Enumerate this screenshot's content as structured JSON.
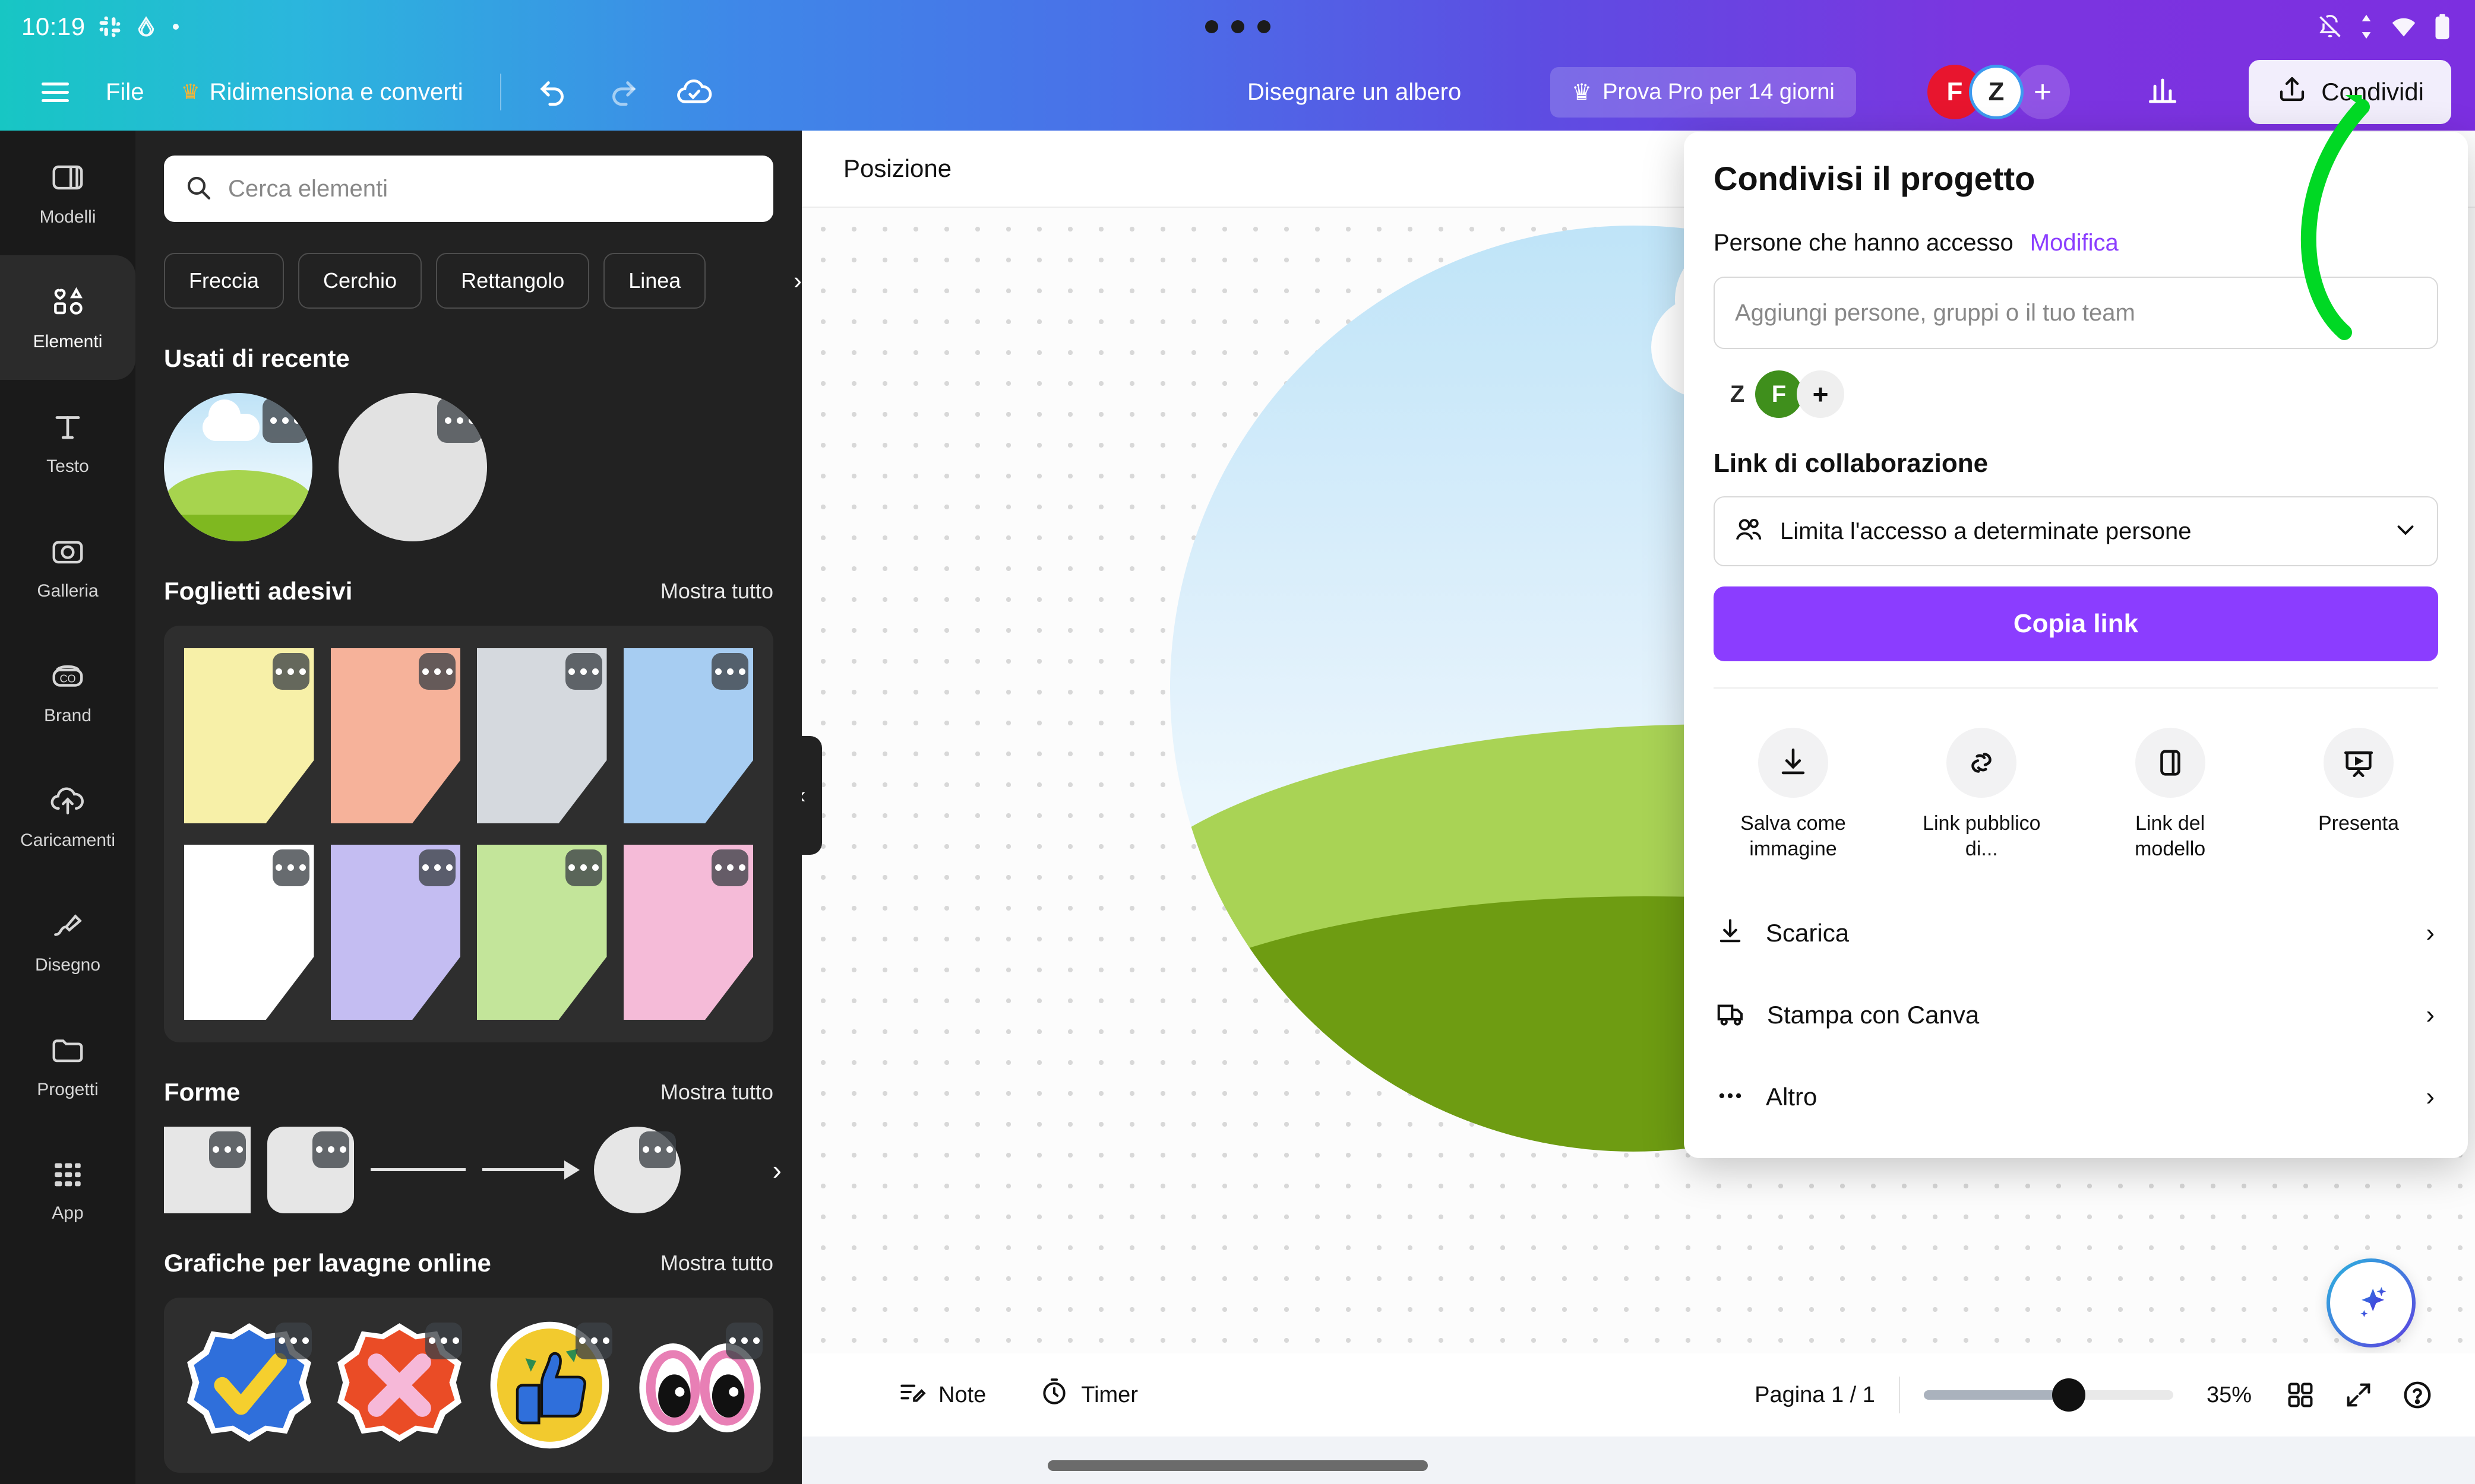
{
  "os": {
    "time": "10:19",
    "icons": [
      "slack-icon",
      "drive-icon",
      "recording-dot-icon"
    ],
    "right_icons": [
      "bell-off-icon",
      "data-transfer-icon",
      "wifi-icon",
      "battery-icon"
    ]
  },
  "header": {
    "menu_icon": "hamburger-icon",
    "file_label": "File",
    "resize_label": "Ridimensiona e converti",
    "resize_crown": "crown-icon",
    "undo_icon": "undo-icon",
    "redo_icon": "redo-icon",
    "cloud_icon": "cloud-saved-icon",
    "doc_title": "Disegnare un albero",
    "pro_label": "Prova Pro per 14 giorni",
    "pro_crown": "crown-icon",
    "avatars": [
      {
        "initial": "F",
        "color": "#e8152e"
      },
      {
        "initial": "Z",
        "color": "#ffffff"
      }
    ],
    "add_collaborator": "+",
    "stats_icon": "bar-chart-icon",
    "share_label": "Condividi",
    "share_icon": "share-upload-icon"
  },
  "rail": {
    "items": [
      {
        "label": "Modelli",
        "icon": "templates-icon",
        "active": false
      },
      {
        "label": "Elementi",
        "icon": "elements-icon",
        "active": true
      },
      {
        "label": "Testo",
        "icon": "text-icon",
        "active": false
      },
      {
        "label": "Galleria",
        "icon": "gallery-icon",
        "active": false
      },
      {
        "label": "Brand",
        "icon": "brand-icon",
        "active": false
      },
      {
        "label": "Caricamenti",
        "icon": "uploads-icon",
        "active": false
      },
      {
        "label": "Disegno",
        "icon": "draw-icon",
        "active": false
      },
      {
        "label": "Progetti",
        "icon": "projects-icon",
        "active": false
      },
      {
        "label": "App",
        "icon": "apps-icon",
        "active": false
      }
    ]
  },
  "panel": {
    "search_placeholder": "Cerca elementi",
    "search_value": "",
    "search_icon": "search-icon",
    "chips": [
      "Freccia",
      "Cerchio",
      "Rettangolo",
      "Linea"
    ],
    "chips_next_icon": "chevron-right-icon",
    "sections": {
      "recent": {
        "title": "Usati di recente"
      },
      "sticky": {
        "title": "Foglietti adesivi",
        "show_all": "Mostra tutto"
      },
      "shapes": {
        "title": "Forme",
        "show_all": "Mostra tutto"
      },
      "graphics": {
        "title": "Grafiche per lavagne online",
        "show_all": "Mostra tutto"
      }
    },
    "sticky_colors": [
      "#f7f0a8",
      "#f6b29a",
      "#d5d9de",
      "#a7cdf2",
      "#ffffff",
      "#c4bdf2",
      "#c3e59a",
      "#f5bbd8"
    ],
    "sticky_fold_colors": [
      "#d9d389",
      "#d79680",
      "#b5bbc2",
      "#8bb0d2",
      "#d4d4d4",
      "#a7a0d2",
      "#a6c580",
      "#d4a0bc"
    ],
    "graphics": [
      "check-badge-sticker",
      "cross-badge-sticker",
      "thumbs-up-sticker",
      "eyes-sticker"
    ],
    "collapse_icon": "chevron-left-icon"
  },
  "canvas": {
    "position_label": "Posizione",
    "page_tab_icon": "chevron-up-icon",
    "ai_icon": "sparkle-ai-icon"
  },
  "bottombar": {
    "note_label": "Note",
    "note_icon": "note-icon",
    "timer_label": "Timer",
    "timer_icon": "timer-icon",
    "page_label": "Pagina 1 / 1",
    "zoom_value": "35%",
    "zoom_percent": 58,
    "grid_icon": "grid-view-icon",
    "fullscreen_icon": "fullscreen-icon",
    "help_icon": "help-icon"
  },
  "share_panel": {
    "title": "Condivisi il progetto",
    "access_label": "Persone che hanno accesso",
    "edit_link": "Modifica",
    "add_placeholder": "Aggiungi persone, gruppi o il tuo team",
    "add_value": "",
    "avatars": [
      {
        "initial": "Z",
        "color": "#ffffff"
      },
      {
        "initial": "F",
        "color": "#3f8f1c"
      }
    ],
    "add_more": "+",
    "collab_title": "Link di collaborazione",
    "access_select": "Limita l'accesso a determinate persone",
    "access_select_icon": "people-icon",
    "access_chevron": "chevron-down-icon",
    "copy_link": "Copia link",
    "actions": [
      {
        "label": "Salva come immagine",
        "icon": "download-image-icon"
      },
      {
        "label": "Link pubblico di...",
        "icon": "public-link-icon"
      },
      {
        "label": "Link del modello",
        "icon": "template-link-icon"
      },
      {
        "label": "Presenta",
        "icon": "present-icon"
      }
    ],
    "list": [
      {
        "label": "Scarica",
        "icon": "download-icon",
        "chevron": "chevron-right-icon"
      },
      {
        "label": "Stampa con Canva",
        "icon": "print-truck-icon",
        "chevron": "chevron-right-icon"
      },
      {
        "label": "Altro",
        "icon": "more-dots-icon",
        "chevron": "chevron-right-icon"
      }
    ]
  },
  "annotation": {
    "arrow_color": "#00d824",
    "arrow_name": "green-pointer-arrow"
  },
  "colors": {
    "accent_purple": "#8b3dff",
    "header_gradient_start": "#17c6c4",
    "header_gradient_end": "#7c2fe0",
    "panel_bg": "#222222",
    "rail_bg": "#1a1a1a"
  }
}
